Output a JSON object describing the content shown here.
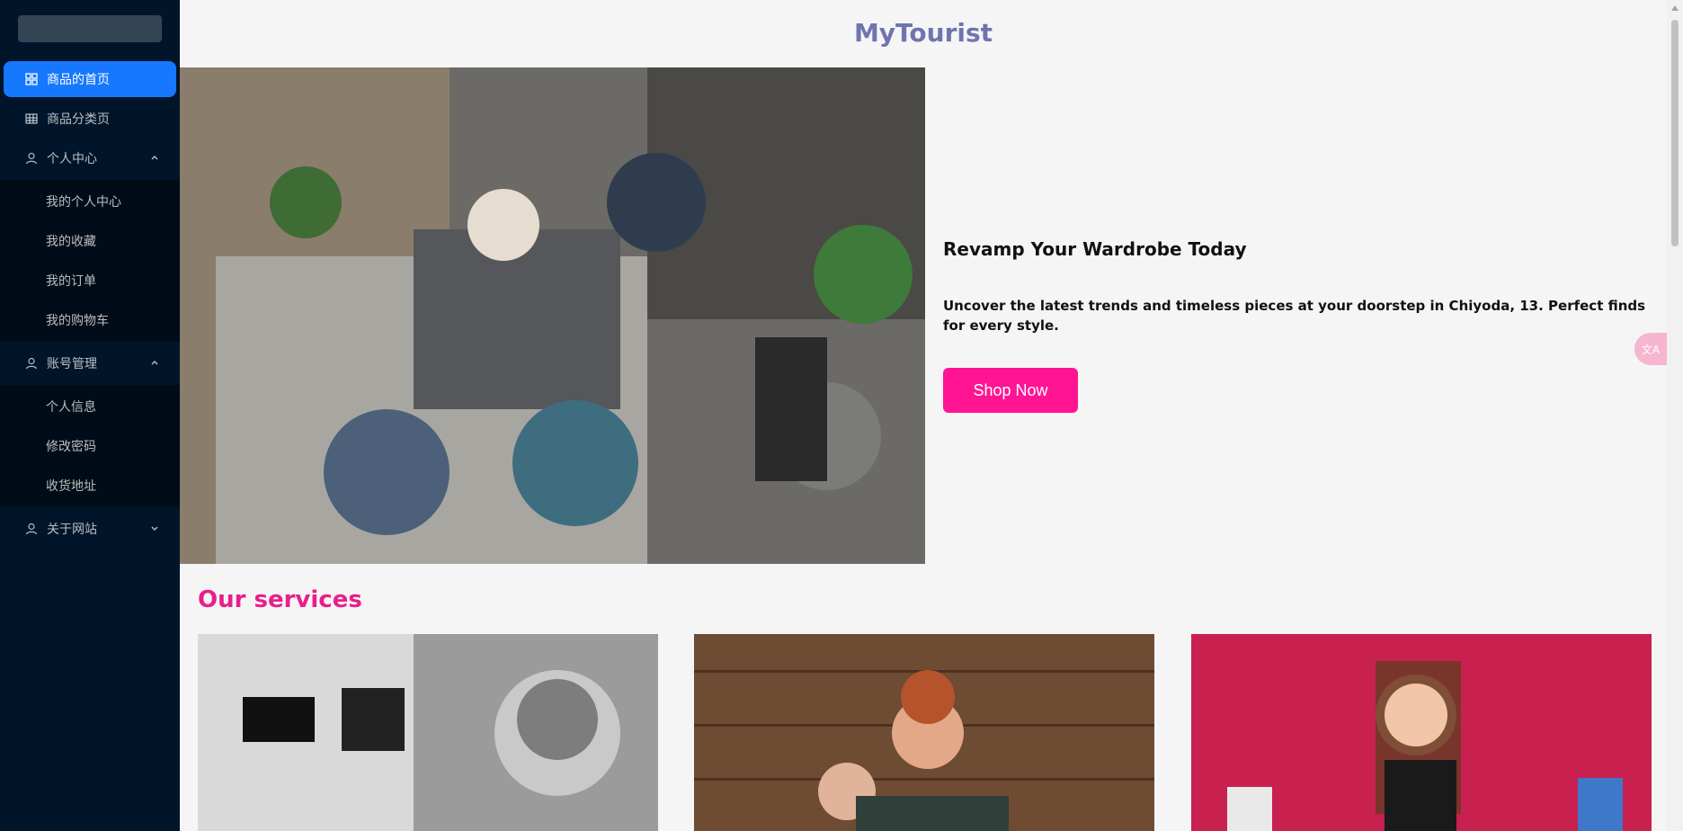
{
  "sidebar": {
    "items": [
      {
        "label": "商品的首页",
        "icon": "grid-icon"
      },
      {
        "label": "商品分类页",
        "icon": "table-icon"
      },
      {
        "label": "个人中心",
        "icon": "user-icon",
        "expanded": true,
        "children": [
          "我的个人中心",
          "我的收藏",
          "我的订单",
          "我的购物车"
        ]
      },
      {
        "label": "账号管理",
        "icon": "user-icon",
        "expanded": true,
        "children": [
          "个人信息",
          "修改密码",
          "收货地址"
        ]
      },
      {
        "label": "关于网站",
        "icon": "user-icon",
        "expanded": false
      }
    ]
  },
  "header": {
    "brand": "MyTourist"
  },
  "hero": {
    "title": "Revamp Your Wardrobe Today",
    "description": "Uncover the latest trends and timeless pieces at your doorstep in Chiyoda, 13. Perfect finds for every style.",
    "cta_label": "Shop Now"
  },
  "services": {
    "title": "Our services"
  },
  "translate": {
    "label": "文A"
  },
  "colors": {
    "sidebar_bg": "#001529",
    "active": "#1677ff",
    "accent": "#ff1493",
    "brand": "#6f74b0"
  }
}
